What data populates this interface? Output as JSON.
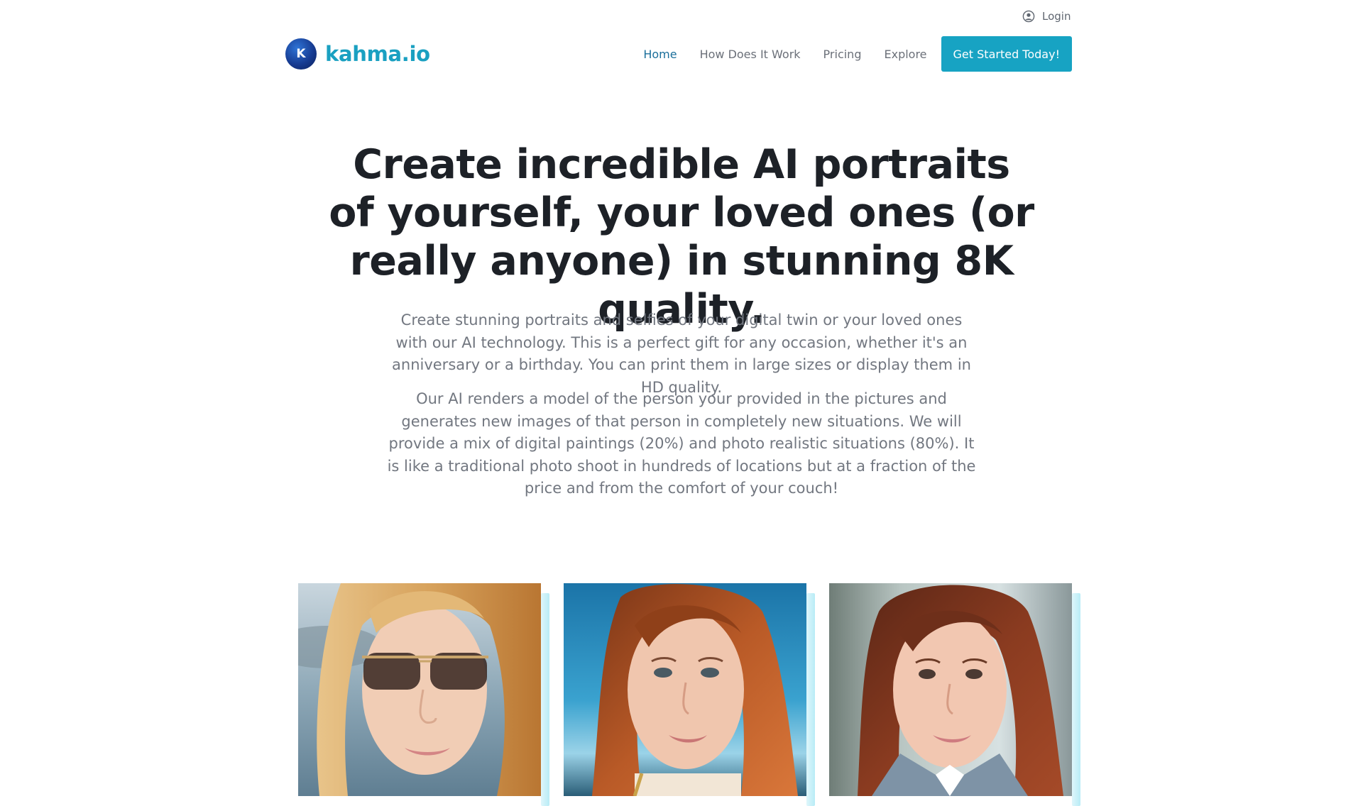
{
  "header": {
    "login_label": "Login",
    "brand_name": "kahma.io",
    "logo_letter": "K",
    "nav": [
      {
        "label": "Home",
        "active": true
      },
      {
        "label": "How Does It Work",
        "active": false
      },
      {
        "label": "Pricing",
        "active": false
      },
      {
        "label": "Explore",
        "active": false
      }
    ],
    "cta_label": "Get Started Today!"
  },
  "hero": {
    "title": "Create incredible AI portraits of yourself, your loved ones (or really anyone) in stunning 8K quality.",
    "paragraph_1": "Create stunning portraits and selfies of your digital twin or your loved ones with our AI technology. This is a perfect gift for any occasion, whether it's an anniversary or a birthday. You can print them in large sizes or display them in HD quality.",
    "paragraph_2": "Our AI renders a model of the person your provided in the pictures and generates new images of that person in completely new situations. We will provide a mix of digital paintings (20%) and photo realistic situations (80%). It is like a traditional photo shoot in hundreds of locations but at a fraction of the price and from the comfort of your couch!"
  },
  "colors": {
    "brand": "#1aa0c1",
    "cta_background": "#17a3c3",
    "active_nav": "#1b6f9b",
    "body_text": "#727780",
    "heading": "#1d2127"
  },
  "icons": {
    "login": "user-circle-icon"
  }
}
